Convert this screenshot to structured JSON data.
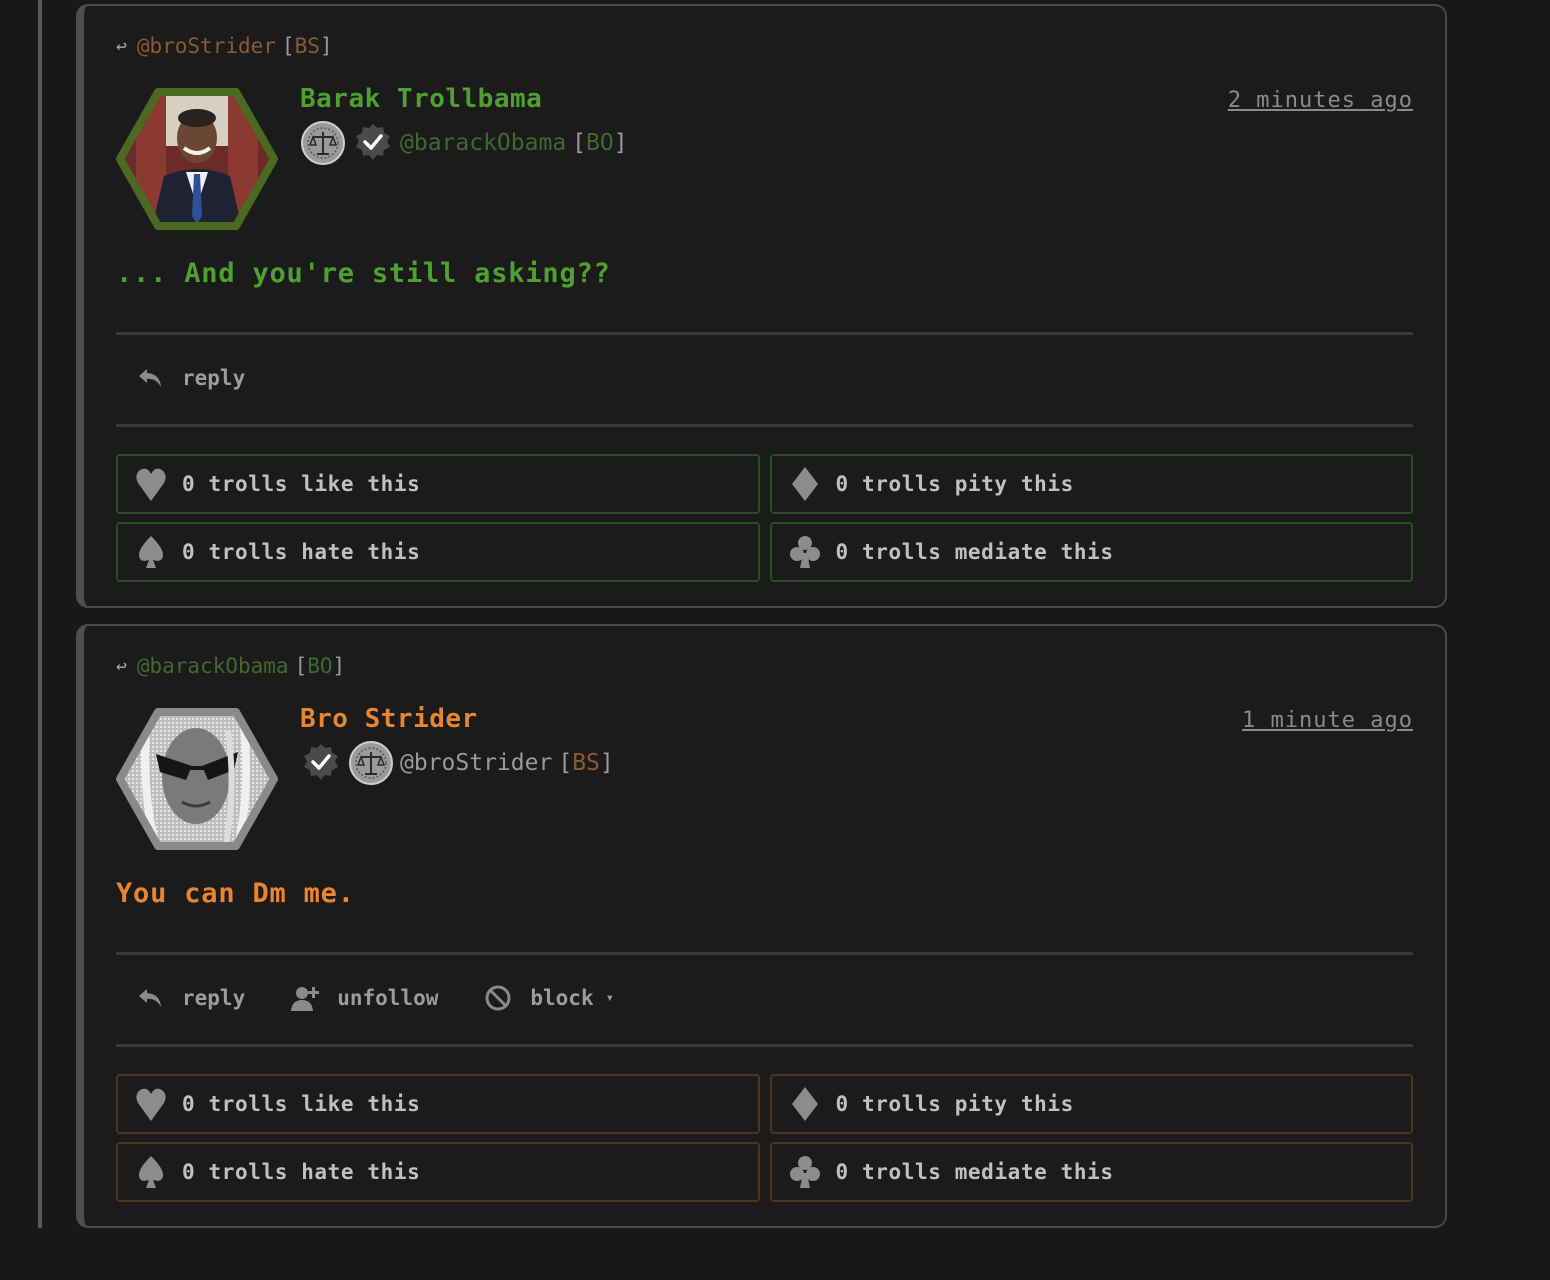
{
  "colors": {
    "green": "#4fa12f",
    "green_dim": "#3f6a2c",
    "orange": "#e8852e",
    "orange_dim": "#8a5a30",
    "gray_text": "#9a9a9a"
  },
  "posts": [
    {
      "reply_to": {
        "handle": "@broStrider",
        "initials": "BS"
      },
      "author": {
        "name": "Barak Trollbama",
        "handle": "@barackObama",
        "initials": "BO",
        "badges": [
          "scales-of-justice-icon",
          "verified-check-icon"
        ]
      },
      "timestamp": "2 minutes ago",
      "body": "... And you're still asking??",
      "actions": [
        {
          "label": "reply",
          "icon": "reply-arrow-icon"
        }
      ],
      "reactions": [
        {
          "label": "0 trolls like this",
          "icon": "heart-icon"
        },
        {
          "label": "0 trolls pity this",
          "icon": "diamond-icon"
        },
        {
          "label": "0 trolls hate this",
          "icon": "spade-icon"
        },
        {
          "label": "0 trolls mediate this",
          "icon": "club-icon"
        }
      ]
    },
    {
      "reply_to": {
        "handle": "@barackObama",
        "initials": "BO"
      },
      "author": {
        "name": "Bro Strider",
        "handle": "@broStrider",
        "initials": "BS",
        "badges": [
          "verified-check-icon",
          "scales-of-justice-icon"
        ]
      },
      "timestamp": "1 minute ago",
      "body": "You can Dm me.",
      "actions": [
        {
          "label": "reply",
          "icon": "reply-arrow-icon"
        },
        {
          "label": "unfollow",
          "icon": "user-plus-icon"
        },
        {
          "label": "block",
          "icon": "block-icon",
          "caret": "▾"
        }
      ],
      "reactions": [
        {
          "label": "0 trolls like this",
          "icon": "heart-icon"
        },
        {
          "label": "0 trolls pity this",
          "icon": "diamond-icon"
        },
        {
          "label": "0 trolls hate this",
          "icon": "spade-icon"
        },
        {
          "label": "0 trolls mediate this",
          "icon": "club-icon"
        }
      ]
    }
  ]
}
